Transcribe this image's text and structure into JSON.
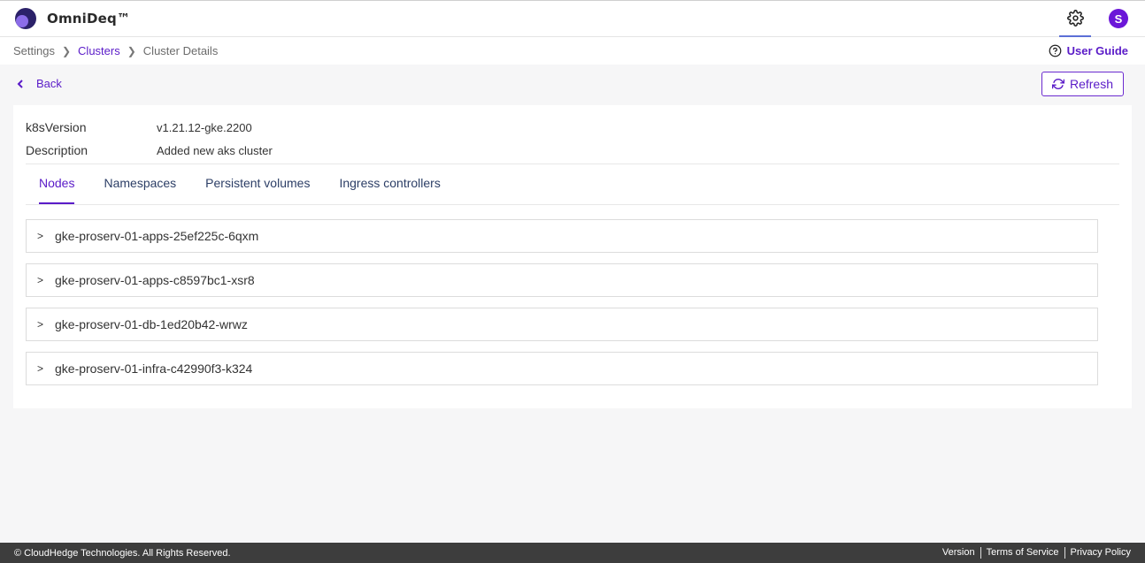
{
  "app": {
    "title": "OmniDeq™"
  },
  "header": {
    "avatar_initial": "S"
  },
  "breadcrumb": {
    "items": [
      "Settings",
      "Clusters",
      "Cluster Details"
    ]
  },
  "user_guide": {
    "label": "User Guide"
  },
  "actions": {
    "back_label": "Back",
    "refresh_label": "Refresh"
  },
  "cluster": {
    "fields": [
      {
        "key": "k8sVersion",
        "value": "v1.21.12-gke.2200"
      },
      {
        "key": "Description",
        "value": "Added new aks cluster"
      }
    ]
  },
  "tabs": [
    {
      "label": "Nodes",
      "active": true
    },
    {
      "label": "Namespaces"
    },
    {
      "label": "Persistent volumes"
    },
    {
      "label": "Ingress controllers"
    }
  ],
  "nodes": [
    "gke-proserv-01-apps-25ef225c-6qxm",
    "gke-proserv-01-apps-c8597bc1-xsr8",
    "gke-proserv-01-db-1ed20b42-wrwz",
    "gke-proserv-01-infra-c42990f3-k324"
  ],
  "footer": {
    "copyright": "© CloudHedge Technologies. All Rights Reserved.",
    "links": [
      "Version",
      "Terms of Service",
      "Privacy Policy"
    ]
  },
  "colors": {
    "accent": "#5a1bc8",
    "avatar": "#6b16d8",
    "footer_bg": "#3d3d3d"
  }
}
